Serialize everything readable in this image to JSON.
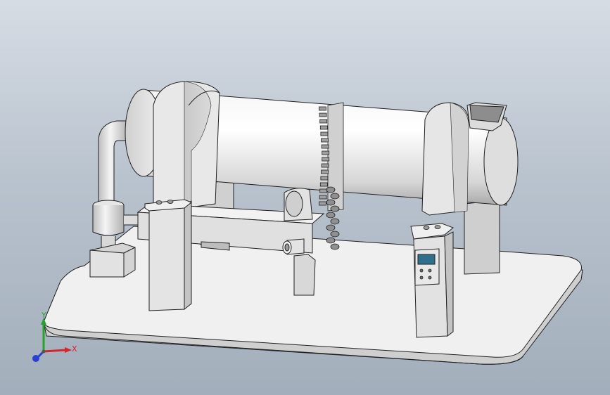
{
  "viewport": {
    "background_top": "#d6dce4",
    "background_bottom": "#a2aebb"
  },
  "triad": {
    "x_label": "X",
    "y_label": "Y",
    "x_color": "#d4262b",
    "y_color": "#2aa12f",
    "z_color": "#2b3fd0"
  },
  "model": {
    "part_color": "#e4e4e4",
    "edge_color": "#202020",
    "display_mode": "shaded-with-edges"
  },
  "controller": {
    "screen_color": "#2f6f8c"
  }
}
